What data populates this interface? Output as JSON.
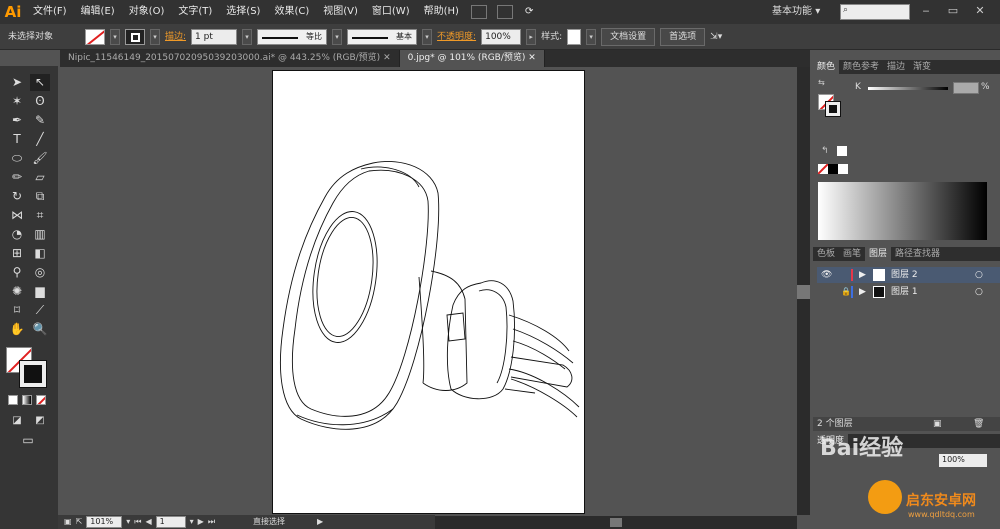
{
  "menubar": {
    "logo": "Ai",
    "items": [
      "文件(F)",
      "编辑(E)",
      "对象(O)",
      "文字(T)",
      "选择(S)",
      "效果(C)",
      "视图(V)",
      "窗口(W)",
      "帮助(H)"
    ],
    "workspace": "基本功能",
    "workspace_arrow": "▾"
  },
  "controlbar": {
    "selection": "未选择对象",
    "stroke_label": "描边:",
    "stroke_value": "1 pt",
    "stroke_profile": "等比",
    "brush": "基本",
    "opacity_label": "不透明度:",
    "opacity_value": "100%",
    "style_label": "样式:",
    "doc_setup": "文档设置",
    "preferences": "首选项"
  },
  "tabs": [
    {
      "label": "Nipic_11546149_20150702095039203000.ai* @ 443.25% (RGB/预览)",
      "close": "✕"
    },
    {
      "label": "0.jpg* @ 101% (RGB/预览)",
      "close": "✕"
    }
  ],
  "panels": {
    "color_tabs": [
      "颜色",
      "颜色参考",
      "描边",
      "渐变"
    ],
    "k_label": "K",
    "k_unit": "%",
    "layer_tabs": [
      "色板",
      "画笔",
      "图层",
      "路径查找器"
    ],
    "layers": [
      {
        "name": "图层 2",
        "color": "#e8374a"
      },
      {
        "name": "图层 1",
        "color": "#3e6fe0"
      }
    ],
    "layer_count": "2 个图层",
    "lower_tab": "透明度",
    "lower_value": "100%"
  },
  "statusbar": {
    "zoom": "101%",
    "page": "1",
    "tool": "直接选择"
  },
  "watermark": {
    "text": "Bai经验",
    "site_text": "启东安卓网",
    "site_url": "www.qdltdq.com"
  },
  "colors": {
    "accent": "#ff9a00",
    "app_bg": "#535353"
  }
}
